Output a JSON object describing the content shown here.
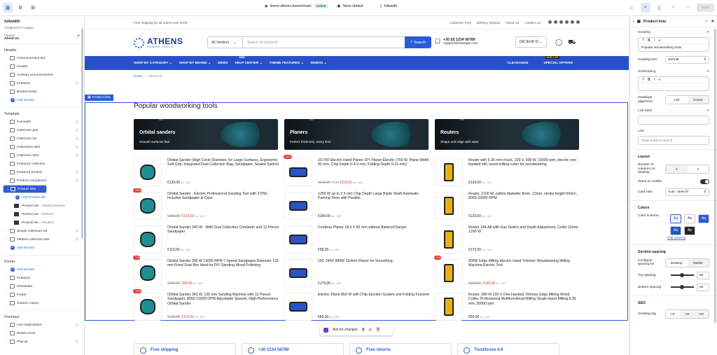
{
  "topbar": {
    "theme_name": "demo-athens-theme/main",
    "theme_status": "Active",
    "store_label": "Store default",
    "template_label": "fullwidth",
    "save_label": "Save"
  },
  "left": {
    "title": "fullwidth",
    "assigned": "Assigned to 0 pages",
    "preview_label": "Preview",
    "preview_page": "About Us",
    "groups": {
      "header": "Header",
      "template": "Template",
      "footer": "Footer",
      "overlays": "Overlays"
    },
    "header_items": [
      "Announcement bar",
      "Header",
      "Auxiliary announcement",
      "Features",
      "Breadcrumbs"
    ],
    "add_section": "Add section",
    "template_items": [
      "Full width",
      "Collection grid",
      "Collection list",
      "Collections lists",
      "Collection tabs",
      "Featured collection",
      "Featured product",
      "Product comparison"
    ],
    "selected_item": "Product lists",
    "add_product_list": "Add Product list",
    "sub_items": [
      {
        "label": "Product list",
        "detail": "– Orbital sanders"
      },
      {
        "label": "Product list",
        "detail": "– Planers"
      },
      {
        "label": "Product list",
        "detail": "– Routers"
      }
    ],
    "template_items_after": [
      "Simple collection list",
      "Tabbed collection lists"
    ],
    "footer_items": [
      "Features",
      "Newsletter",
      "Footer",
      "Custom Liquid"
    ],
    "overlay_items": [
      "Live notifications",
      "Mobile Dock",
      "Pop-up"
    ]
  },
  "store": {
    "announcement": "Free shipping for all orders over €100",
    "ann_links": [
      "Customer FAQ",
      "Delivery Options",
      "About Us",
      "Contact Us"
    ],
    "logo_main": "ATHENS",
    "logo_sub": "POWER TOOLS",
    "vendor_select": "All Vendors",
    "search_placeholder": "Search for products",
    "search_button": "Search",
    "phone": "+30 (0) 1234 56789",
    "email": "support@example.com",
    "currency": "GR (EUR €)",
    "nav": [
      "SHOP BY CATEGORY",
      "SHOP BY BRAND",
      "NEWS",
      "HELP CENTER",
      "THEME FEATURES",
      "DEMOS"
    ],
    "nav_new_badge": "NEW",
    "nav_right": [
      "CLEARANCE",
      "SPECIAL OFFERS"
    ],
    "nav_soon_badge": "NOW LIVE",
    "crumb_home": "Home",
    "crumb_sep": "›",
    "crumb_current": "About Us",
    "section_tag": "Product lists",
    "section_title": "Popular woodworking tools",
    "banners": [
      {
        "title": "Orbital sanders",
        "subtitle": "Smooth surfaces fast"
      },
      {
        "title": "Planers",
        "subtitle": "Perfect thickness, every time"
      },
      {
        "title": "Routers",
        "subtitle": "Shape and edge with ease"
      }
    ],
    "products": [
      {
        "title": "Orbital Sander (High Circle Diameter, for Large Surfaces, Ergonomic Soft Grip, Integrated Dust Collection Bag, Sandpaper, Sealed Switch)",
        "old": "",
        "from": "",
        "price": "€139,00",
        "red": false,
        "discount": "",
        "kind": "sander"
      },
      {
        "title": "10-750 Electric Hand Planer DIY Planer Electric (750 W, Plane Width 82 mm, Chip Depth 0-3.0 mm, Folding Depth 0-15 mm)",
        "old": "€249,00",
        "from": "from",
        "price": "€119,00",
        "red": true,
        "discount": "-50%",
        "kind": "planer"
      },
      {
        "title": "Router with 6.35 mm chuck, 220 V, 600 W, 10000 rpm, electric one-handed mill, wood milling cutter for woodworking",
        "old": "",
        "from": "",
        "price": "€139,00",
        "red": false,
        "discount": "",
        "kind": "router"
      },
      {
        "title": "Orbital Sander - Electric Professional Sanding Tool with 270W - Includes Sandpaper & Case",
        "old": "€159,00",
        "from": "",
        "price": "€129,00",
        "red": true,
        "discount": "-19%",
        "kind": "sander"
      },
      {
        "title": "1050 W up to 2.5 mm Chip Depth Large Blade Shaft Automatic Parking Shoe with Parallel",
        "old": "",
        "from": "",
        "price": "€189,00",
        "red": false,
        "discount": "",
        "kind": "planer"
      },
      {
        "title": "Router, 2100 W, collets diameter 8mm, 12mm, stroke height 60mm, 8000-23000 RPM",
        "old": "",
        "from": "",
        "price": "€129,00",
        "red": false,
        "discount": "",
        "kind": "router"
      },
      {
        "title": "Orbital Sander 240 W - With Dust Collection Container and 12 Pieces Sandpaper",
        "old": "",
        "from": "",
        "price": "€119,00",
        "red": false,
        "discount": "",
        "kind": "sander"
      },
      {
        "title": "Cordless Planer 18.0 V 82 mm without Battery/Charger",
        "old": "",
        "from": "",
        "price": "€99,00",
        "red": false,
        "discount": "",
        "kind": "planer"
      },
      {
        "title": "Router 184 AA with Gas Switch and Depth Adjustment, Collet 12mm, 1200 W",
        "old": "",
        "from": "",
        "price": "€179,00",
        "red": false,
        "discount": "",
        "kind": "router"
      },
      {
        "title": "Orbital Sander 300 W 13000 RPM 7 Speed Sandpaper Diameter 125 mm Fixed Dust Box Ideal for DIY Sanding Wood Polishing",
        "old": "€109,00",
        "from": "",
        "price": "€99,00",
        "red": true,
        "discount": "-9%",
        "kind": "sander"
      },
      {
        "title": "19C 240V 840W 110mm Planer for Smoothing",
        "old": "",
        "from": "",
        "price": "€179,00",
        "red": false,
        "discount": "",
        "kind": "planer"
      },
      {
        "title": "800W Edge Milling Electric Hand Trimmer Woodworking Milling Machine Electric Tool",
        "old": "€219,00",
        "from": "",
        "price": "€199,00",
        "red": true,
        "discount": "-9%",
        "kind": "router"
      },
      {
        "title": "Orbital Sander 360 W, 125 mm Sanding Machine with 12 Pieces Sandpaper, 8000-13000 OPM Adjustable Speeds, High-Performance Orbital Sander",
        "old": "€139,00",
        "from": "",
        "price": "€119,00",
        "red": true,
        "discount": "-14%",
        "kind": "sander"
      },
      {
        "title": "Electric Plane 850 W with Chip Ejection System and Folding Function",
        "old": "",
        "from": "",
        "price": "€89,00",
        "red": false,
        "discount": "",
        "kind": "planer"
      },
      {
        "title": "Router, 580 W 220 V One-Handed Trimmer Edge Milling Wood Cutter, Professional Multifunctional Milling Single-Hand Milling 6.35 mm, 30000 rpm",
        "old": "",
        "from": "",
        "price": "€99,00",
        "red": false,
        "discount": "",
        "kind": "router"
      }
    ],
    "vat": "inc. VAT",
    "features": [
      "Free shipping",
      "+30 1234 56789",
      "Free returns",
      "TrustScore 4.9"
    ]
  },
  "floatbar": {
    "ask": "Ask for changes"
  },
  "right": {
    "title": "Product lists",
    "heading_label": "Heading",
    "heading_value": "Popular woodworking tools",
    "heading_size_label": "Heading size",
    "heading_size_value": "Normal",
    "subheading_label": "Subheading",
    "align_label": "Headings alignment",
    "align_options": [
      "Left",
      "Center"
    ],
    "link_label_label": "Link label",
    "link_label": "Link",
    "link_placeholder": "Paste a link or search",
    "layout_heading": "Layout",
    "columns_label": "Number of columns on desktop",
    "columns_options": [
      "2",
      "3"
    ],
    "stack_label": "Stack on mobile",
    "card_ratio_label": "Card ratio",
    "card_ratio_value": "Auto - Best fit",
    "colors_heading": "Colors",
    "scheme_label": "Color scheme",
    "scheme_glyph": "Aa",
    "edit_scheme": "Edit scheme",
    "spacing_heading": "Section spacing",
    "configure_label": "Configure spacing for",
    "configure_options": [
      "Desktop",
      "Mobile"
    ],
    "top_label": "Top spacing",
    "top_value": "60",
    "bottom_label": "Bottom spacing",
    "bottom_value": "60",
    "seo_heading": "SEO",
    "heading_tag_label": "Heading tag",
    "heading_tags": [
      "H1",
      "H2",
      "H3"
    ]
  },
  "colors": {
    "accent": "#2b5bd7",
    "nav": "#2a50c8",
    "sale": "#e53935"
  }
}
